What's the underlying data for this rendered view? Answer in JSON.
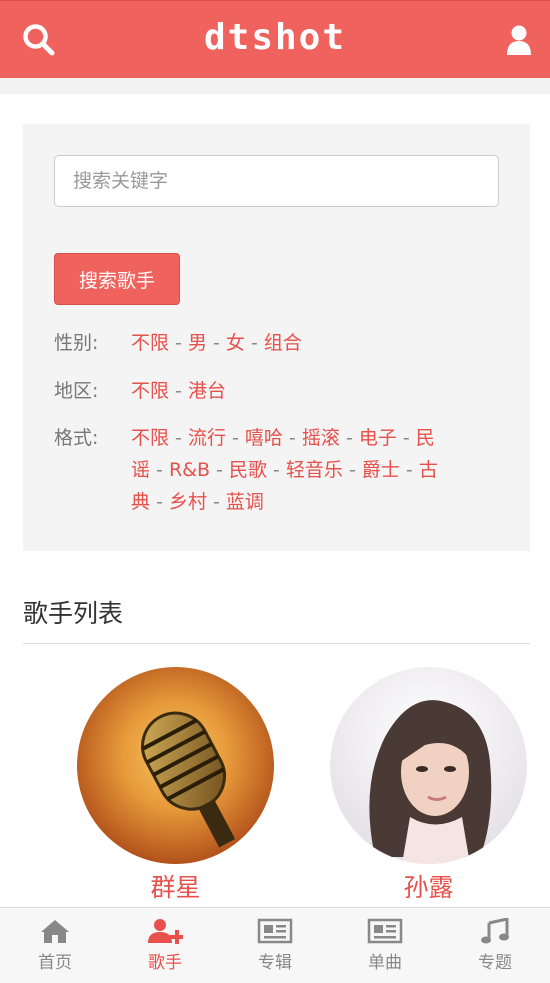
{
  "header": {
    "title": "dtshot",
    "search_icon": "search-icon",
    "user_icon": "user-icon",
    "accent": "#f0625d"
  },
  "search": {
    "placeholder": "搜索关键字",
    "value": "",
    "button_label": "搜索歌手"
  },
  "filters": {
    "gender": {
      "label": "性别:",
      "options": [
        "不限",
        "男",
        "女",
        "组合"
      ]
    },
    "region": {
      "label": "地区:",
      "options": [
        "不限",
        "港台"
      ]
    },
    "style": {
      "label": "格式:",
      "options": [
        "不限",
        "流行",
        "嘻哈",
        "摇滚",
        "电子",
        "民谣",
        "R&B",
        "民歌",
        "轻音乐",
        "爵士",
        "古典",
        "乡村",
        "蓝调"
      ]
    },
    "separator": "-"
  },
  "singer_list": {
    "title": "歌手列表",
    "items": [
      {
        "name": "群星",
        "avatar": "microphone-photo"
      },
      {
        "name": "孙露",
        "avatar": "singer-portrait-photo"
      }
    ]
  },
  "bottom_nav": {
    "items": [
      {
        "label": "首页",
        "icon": "home-icon",
        "active": false
      },
      {
        "label": "歌手",
        "icon": "add-user-icon",
        "active": true
      },
      {
        "label": "专辑",
        "icon": "newspaper-icon",
        "active": false
      },
      {
        "label": "单曲",
        "icon": "newspaper-icon",
        "active": false
      },
      {
        "label": "专题",
        "icon": "music-note-icon",
        "active": false
      }
    ]
  }
}
